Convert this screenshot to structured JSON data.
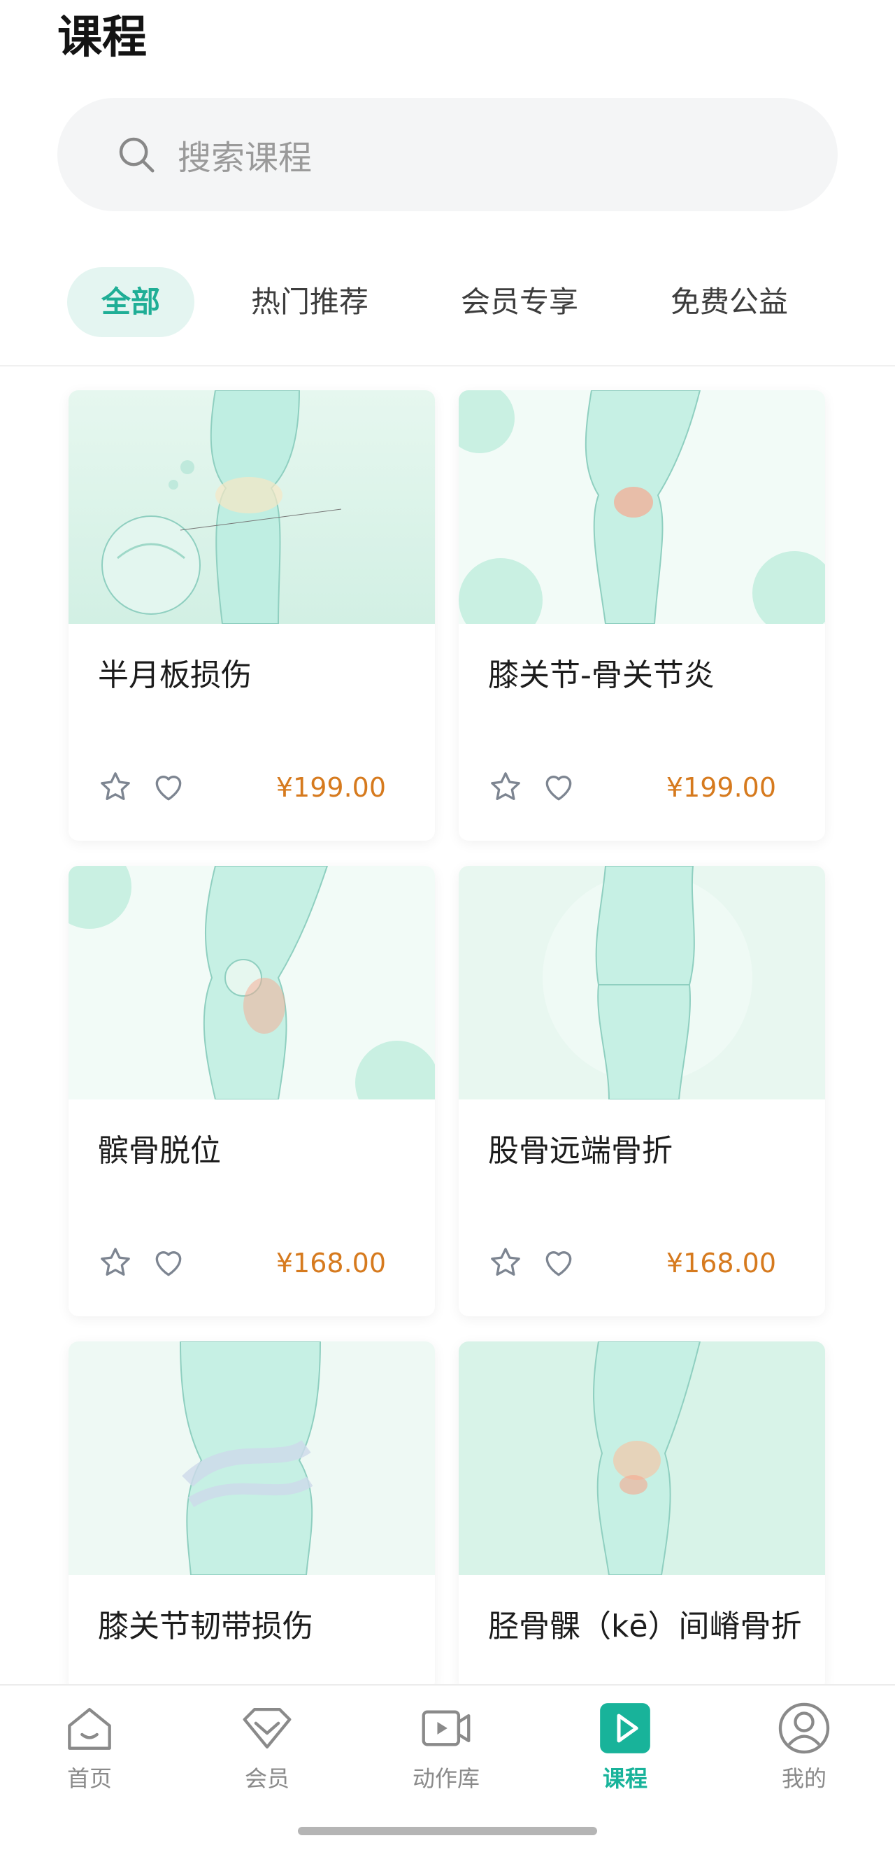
{
  "header": {
    "title": "课程"
  },
  "search": {
    "placeholder": "搜索课程"
  },
  "tabs": [
    {
      "label": "全部",
      "active": true
    },
    {
      "label": "热门推荐",
      "active": false
    },
    {
      "label": "会员专享",
      "active": false
    },
    {
      "label": "免费公益",
      "active": false
    }
  ],
  "courses": [
    {
      "title": "半月板损伤",
      "price": "¥199.00"
    },
    {
      "title": "膝关节-骨关节炎",
      "price": "¥199.00"
    },
    {
      "title": "髌骨脱位",
      "price": "¥168.00"
    },
    {
      "title": "股骨远端骨折",
      "price": "¥168.00"
    },
    {
      "title": "膝关节韧带损伤",
      "price": ""
    },
    {
      "title": "胫骨髁（kē）间嵴骨折",
      "price": ""
    }
  ],
  "icons": {
    "favorite": "star-icon",
    "like": "heart-icon",
    "search": "search-icon"
  },
  "bottom_nav": [
    {
      "label": "首页",
      "icon": "home-icon"
    },
    {
      "label": "会员",
      "icon": "vip-diamond-icon"
    },
    {
      "label": "动作库",
      "icon": "video-camera-icon"
    },
    {
      "label": "课程",
      "icon": "play-icon",
      "active": true
    },
    {
      "label": "我的",
      "icon": "profile-icon"
    }
  ],
  "colors": {
    "accent": "#1fae96",
    "price": "#d67a1e",
    "tab_active_bg": "#e4f5f1"
  }
}
